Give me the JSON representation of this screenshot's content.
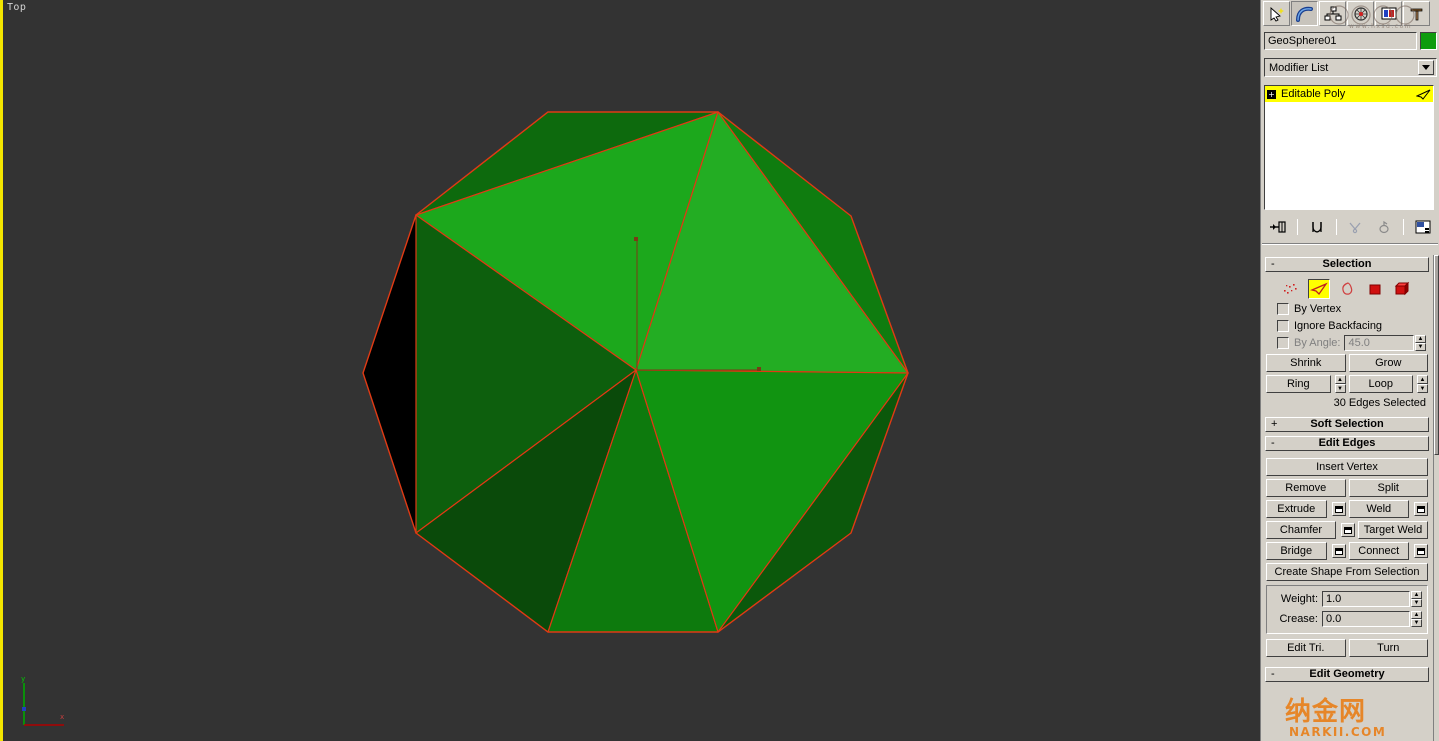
{
  "viewport": {
    "label": "Top",
    "background_color": "#333333",
    "active_border_color": "#f3e600",
    "axis_tripod": {
      "y_label": "y",
      "x_label": "x",
      "y_color": "#00b000",
      "x_color": "#c00000"
    },
    "object": {
      "name": "GeoSphere01",
      "selected_edge_color": "#e03010",
      "face_colors": [
        "#1fa81f",
        "#148a14",
        "#0e6b0e",
        "#0a4f0a",
        "#063406",
        "#000000"
      ]
    }
  },
  "command_panel": {
    "tabs": [
      {
        "name": "create-tab",
        "icon": "arrow-star-icon",
        "active": false
      },
      {
        "name": "modify-tab",
        "icon": "bent-pipe-icon",
        "active": true
      },
      {
        "name": "hierarchy-tab",
        "icon": "hierarchy-icon",
        "active": false
      },
      {
        "name": "motion-tab",
        "icon": "wheel-icon",
        "active": false
      },
      {
        "name": "display-tab",
        "icon": "display-icon",
        "active": false
      },
      {
        "name": "utilities-tab",
        "icon": "hammer-icon",
        "active": false
      }
    ],
    "object_name": "GeoSphere01",
    "object_color": "#0e9c0e",
    "modifier_list_label": "Modifier List",
    "modifier_stack": [
      {
        "label": "Editable Poly",
        "selected": true,
        "expandable": "+"
      }
    ],
    "stack_tools": [
      {
        "name": "pin-stack-icon"
      },
      {
        "name": "show-end-result-icon"
      },
      {
        "name": "make-unique-icon"
      },
      {
        "name": "remove-modifier-icon"
      },
      {
        "name": "configure-modifier-sets-icon"
      }
    ],
    "rollouts": {
      "selection": {
        "sign": "-",
        "title": "Selection",
        "subobject_modes": [
          {
            "name": "vertex",
            "icon": "vertex-dots-icon",
            "active": false
          },
          {
            "name": "edge",
            "icon": "edge-icon",
            "active": true
          },
          {
            "name": "border",
            "icon": "border-icon",
            "active": false
          },
          {
            "name": "polygon",
            "icon": "polygon-icon",
            "active": false
          },
          {
            "name": "element",
            "icon": "element-cube-icon",
            "active": false
          }
        ],
        "by_vertex_label": "By Vertex",
        "ignore_backfacing_label": "Ignore Backfacing",
        "by_angle_label": "By Angle:",
        "by_angle_value": "45.0",
        "shrink_label": "Shrink",
        "grow_label": "Grow",
        "ring_label": "Ring",
        "loop_label": "Loop",
        "status": "30 Edges Selected"
      },
      "soft_selection": {
        "sign": "+",
        "title": "Soft Selection"
      },
      "edit_edges": {
        "sign": "-",
        "title": "Edit Edges",
        "insert_vertex_label": "Insert Vertex",
        "remove_label": "Remove",
        "split_label": "Split",
        "extrude_label": "Extrude",
        "weld_label": "Weld",
        "chamfer_label": "Chamfer",
        "target_weld_label": "Target Weld",
        "bridge_label": "Bridge",
        "connect_label": "Connect",
        "create_shape_label": "Create Shape From Selection",
        "weight_label": "Weight:",
        "weight_value": "1.0",
        "crease_label": "Crease:",
        "crease_value": "0.0",
        "edit_tri_label": "Edit Tri.",
        "turn_label": "Turn"
      },
      "edit_geometry": {
        "sign": "-",
        "title": "Edit Geometry"
      }
    }
  },
  "watermarks": {
    "bottom_text": "NARKII.COM",
    "bottom_cn": "纳金网",
    "top_cn": "火星时代",
    "top_url": "www.hxsd.com",
    "color": "#e88020"
  }
}
